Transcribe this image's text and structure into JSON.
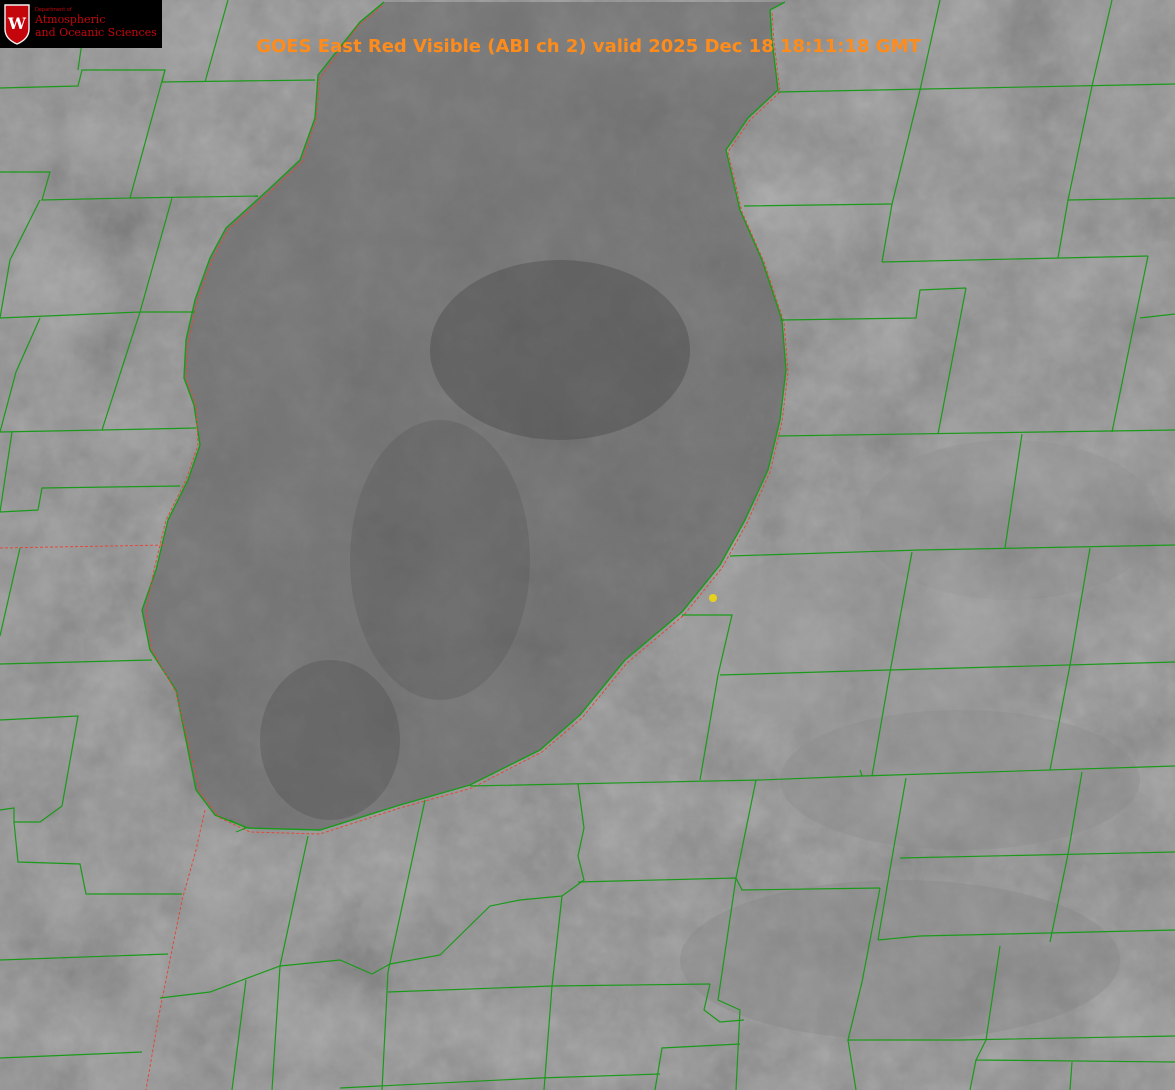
{
  "title": "GOES East Red Visible (ABI ch 2) valid 2025 Dec 18 18:11:18 GMT",
  "logo": {
    "department": "Department of",
    "line1": "Atmospheric",
    "line2": "and Oceanic Sciences",
    "crest_letter": "W"
  },
  "colors": {
    "county_lines": "#1a9a1a",
    "state_lines": "#e04a3a",
    "title_text": "#ff8c1a",
    "logo_text": "#c5050c",
    "site_marker": "#e6d21e"
  },
  "map": {
    "imagery": "visible satellite cloud imagery",
    "lake": "lake outline with shoreline"
  }
}
